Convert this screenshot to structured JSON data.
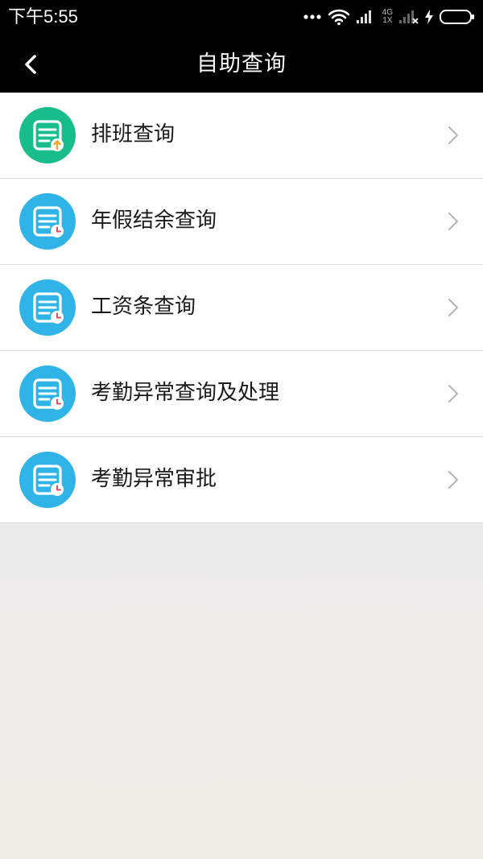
{
  "status_bar": {
    "time": "下午5:55",
    "network_top": "4G",
    "network_bottom": "1X"
  },
  "header": {
    "title": "自助查询",
    "back_icon": "chevron-left-icon"
  },
  "menu": {
    "items": [
      {
        "label": "排班查询",
        "icon": "document-upload-icon",
        "color": "#19bc8b"
      },
      {
        "label": "年假结余查询",
        "icon": "document-clock-icon",
        "color": "#30b4e8"
      },
      {
        "label": "工资条查询",
        "icon": "document-clock-icon",
        "color": "#30b4e8"
      },
      {
        "label": "考勤异常查询及处理",
        "icon": "document-clock-icon",
        "color": "#30b4e8"
      },
      {
        "label": "考勤异常审批",
        "icon": "document-clock-icon",
        "color": "#30b4e8"
      }
    ]
  },
  "colors": {
    "bar_background": "#000000",
    "list_background": "#ffffff",
    "green_icon": "#19bc8b",
    "blue_icon": "#30b4e8",
    "badge_orange": "#f5a623",
    "badge_red": "#e8485b"
  }
}
